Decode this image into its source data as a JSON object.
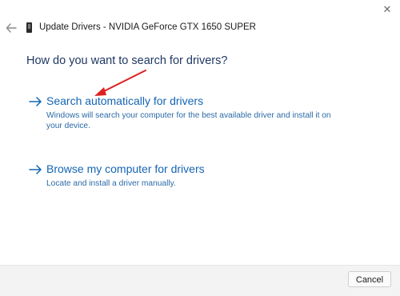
{
  "window": {
    "title": "Update Drivers - NVIDIA GeForce GTX 1650 SUPER",
    "close_glyph": "✕"
  },
  "main": {
    "question": "How do you want to search for drivers?",
    "options": [
      {
        "title": "Search automatically for drivers",
        "description": "Windows will search your computer for the best available driver and install it on your device."
      },
      {
        "title": "Browse my computer for drivers",
        "description": "Locate and install a driver manually."
      }
    ]
  },
  "footer": {
    "cancel_label": "Cancel"
  },
  "colors": {
    "link": "#1464b4",
    "heading": "#1f3864",
    "annotation": "#e02020"
  },
  "icons": {
    "back": "back-arrow-icon",
    "device": "device-icon",
    "option_arrow": "arrow-right-icon",
    "close": "close-icon"
  }
}
